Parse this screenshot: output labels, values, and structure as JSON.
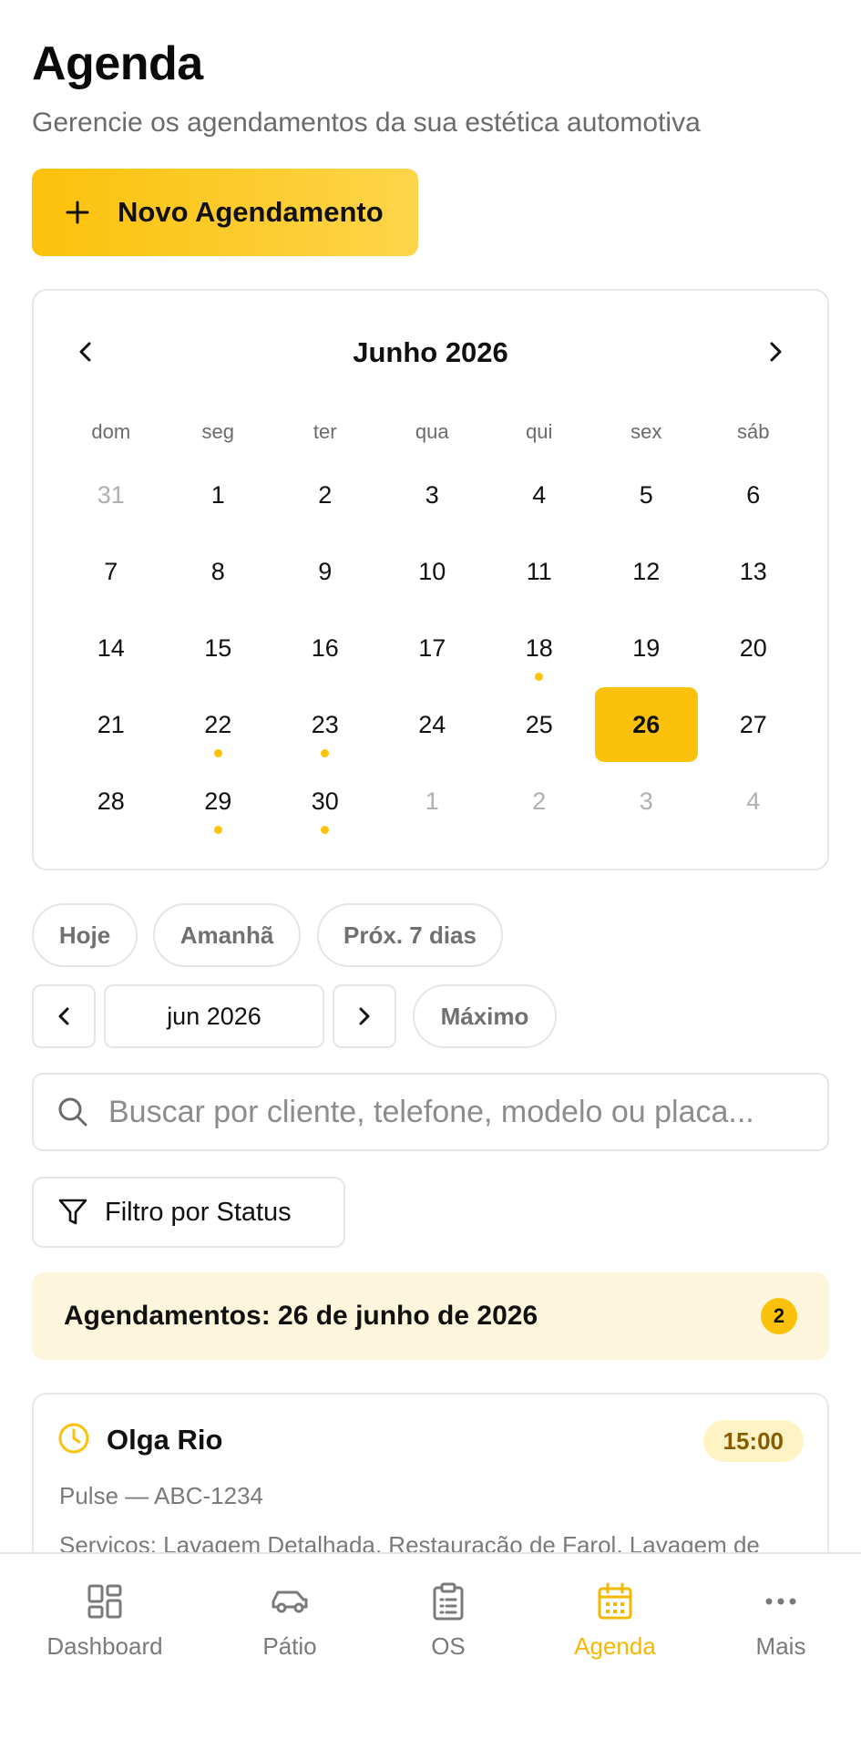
{
  "header": {
    "title": "Agenda",
    "subtitle": "Gerencie os agendamentos da sua estética automotiva"
  },
  "new_button": {
    "label": "Novo Agendamento",
    "icon": "plus-icon"
  },
  "calendar": {
    "month_label": "Junho 2026",
    "weekdays": [
      "dom",
      "seg",
      "ter",
      "qua",
      "qui",
      "sex",
      "sáb"
    ],
    "weeks": [
      [
        {
          "d": "31",
          "muted": true
        },
        {
          "d": "1"
        },
        {
          "d": "2"
        },
        {
          "d": "3"
        },
        {
          "d": "4"
        },
        {
          "d": "5"
        },
        {
          "d": "6"
        }
      ],
      [
        {
          "d": "7"
        },
        {
          "d": "8"
        },
        {
          "d": "9"
        },
        {
          "d": "10"
        },
        {
          "d": "11"
        },
        {
          "d": "12"
        },
        {
          "d": "13"
        }
      ],
      [
        {
          "d": "14"
        },
        {
          "d": "15"
        },
        {
          "d": "16"
        },
        {
          "d": "17"
        },
        {
          "d": "18",
          "event": true
        },
        {
          "d": "19"
        },
        {
          "d": "20"
        }
      ],
      [
        {
          "d": "21"
        },
        {
          "d": "22",
          "event": true
        },
        {
          "d": "23",
          "event": true
        },
        {
          "d": "24"
        },
        {
          "d": "25"
        },
        {
          "d": "26",
          "selected": true
        },
        {
          "d": "27"
        }
      ],
      [
        {
          "d": "28"
        },
        {
          "d": "29",
          "event": true
        },
        {
          "d": "30",
          "event": true
        },
        {
          "d": "1",
          "muted": true
        },
        {
          "d": "2",
          "muted": true
        },
        {
          "d": "3",
          "muted": true
        },
        {
          "d": "4",
          "muted": true
        }
      ]
    ],
    "selected_color": "#fcc10a"
  },
  "quick_filters": {
    "today": "Hoje",
    "tomorrow": "Amanhã",
    "next7": "Próx. 7 dias"
  },
  "period": {
    "month": "jun 2026",
    "max": "Máximo"
  },
  "search": {
    "placeholder": "Buscar por cliente, telefone, modelo ou placa..."
  },
  "status_filter": {
    "label": "Filtro por Status"
  },
  "day_banner": {
    "label": "Agendamentos: 26 de junho de 2026",
    "count": "2"
  },
  "appointments": [
    {
      "name": "Olga Rio",
      "time": "15:00",
      "vehicle": "Pulse — ABC-1234",
      "services": "Serviços: Lavagem Detalhada, Restauração de Farol, Lavagem de"
    }
  ],
  "bottom_nav": [
    {
      "label": "Dashboard",
      "icon": "dashboard-icon"
    },
    {
      "label": "Pátio",
      "icon": "car-icon"
    },
    {
      "label": "OS",
      "icon": "clipboard-icon"
    },
    {
      "label": "Agenda",
      "icon": "calendar-icon",
      "active": true
    },
    {
      "label": "Mais",
      "icon": "more-icon"
    }
  ],
  "colors": {
    "accent": "#fcc10a",
    "accent_soft": "#fdf6dc",
    "muted_text": "#6b6b6b"
  }
}
